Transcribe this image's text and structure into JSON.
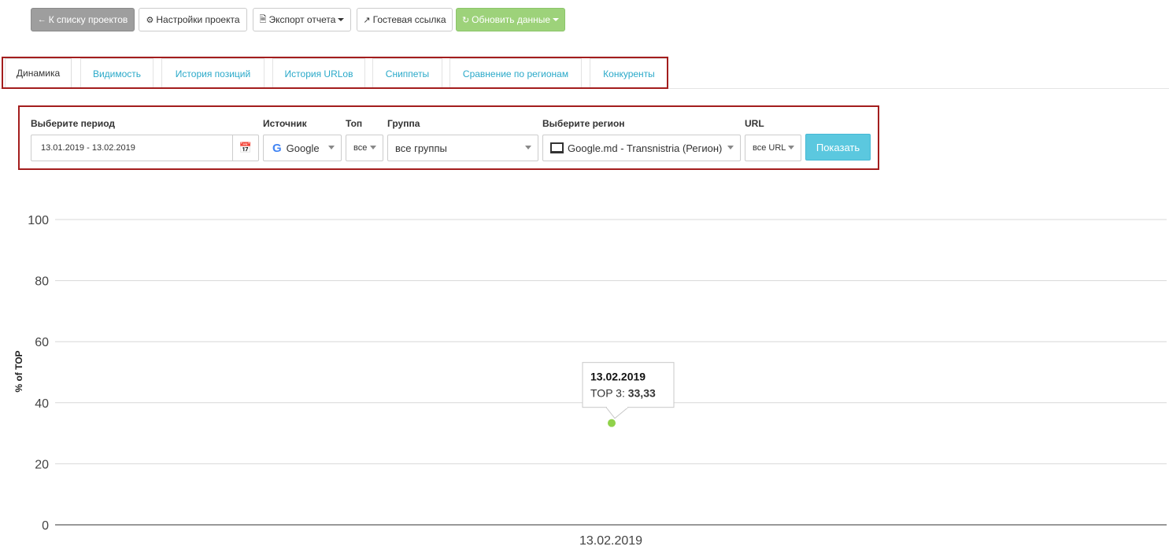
{
  "toolbar": {
    "back_label": "К списку проектов",
    "settings_label": "Настройки проекта",
    "export_label": "Экспорт отчета",
    "guest_label": "Гостевая ссылка",
    "refresh_label": "Обновить данные"
  },
  "tabs": [
    {
      "label": "Динамика",
      "active": true
    },
    {
      "label": "Видимость"
    },
    {
      "label": "История позиций"
    },
    {
      "label": "История URLов"
    },
    {
      "label": "Сниппеты"
    },
    {
      "label": "Сравнение по регионам"
    },
    {
      "label": "Конкуренты"
    }
  ],
  "filters": {
    "period_label": "Выберите период",
    "period_value": "13.01.2019 - 13.02.2019",
    "source_label": "Источник",
    "source_value": "Google",
    "top_label": "Топ",
    "top_value": "все",
    "group_label": "Группа",
    "group_value": "все группы",
    "region_label": "Выберите регион",
    "region_value": "Google.md - Transnistria (Регион)",
    "url_label": "URL",
    "url_value": "все URL",
    "show_label": "Показать"
  },
  "colors": {
    "accent_cyan": "#5bc8df",
    "tab_link": "#2aa9c9",
    "highlight_frame": "#a31d1d",
    "refresh_green": "#9dd27a",
    "point_green": "#90d24a"
  },
  "chart_data": {
    "type": "scatter",
    "ylabel": "% of TOP",
    "ylim": [
      0,
      100
    ],
    "y_ticks": [
      "0",
      "20",
      "40",
      "60",
      "80",
      "100"
    ],
    "categories": [
      "13.02.2019"
    ],
    "series": [
      {
        "name": "TOP 3",
        "values": [
          33.33
        ]
      }
    ],
    "tooltip": {
      "date": "13.02.2019",
      "series_name": "TOP 3",
      "value_text": "33,33"
    }
  }
}
